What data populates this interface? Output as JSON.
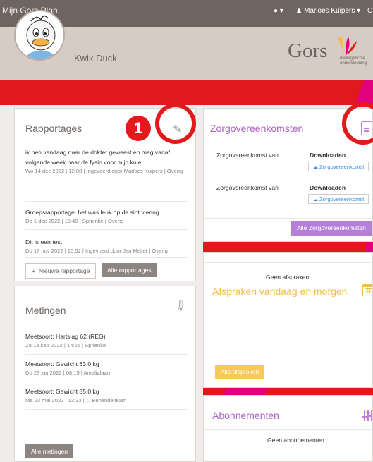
{
  "app": {
    "title": "Mijn Gors Plan"
  },
  "topbar": {
    "info_icon": "info-icon",
    "info_caret": "▾",
    "user_name": "Marloes Kuipers",
    "user_caret": "▾",
    "trail": "C"
  },
  "profile": {
    "name": "Kwik Duck"
  },
  "logo": {
    "word": "Gors",
    "tagline_1": "meesgerichte",
    "tagline_2": "ondersteuning"
  },
  "rapportages": {
    "title": "Rapportages",
    "items": [
      {
        "text": "ik ben vandaag naar de dokter geweest en mag vanaf volgende week naar de fysio voor mijn knie",
        "meta": "Wo 14 dec 2022 | 12:08 | Ingevoerd door Marloes Kuipers | Overig"
      },
      {
        "text": "Groepsrapportage: het was leuk op de sint viering",
        "meta": "Do 1 dec 2022 | 15:40 | Sprienke | Overig"
      },
      {
        "text": "Dit is een test",
        "meta": "Do 17 nov 2022 | 15:52 | Ingevoerd door Jan Meijer | Overig"
      }
    ],
    "new_button": "Nieuwe rapportage",
    "new_button_icon": "+",
    "all_button": "Alle rapportages"
  },
  "metingen": {
    "title": "Metingen",
    "items": [
      {
        "text": "Meetsoort: Hartslag 62 (REG)",
        "meta": "Zo 18 sep 2022 | 14:26 | Sprienke"
      },
      {
        "text": "Meetsoort: Gewicht 63,0 kg",
        "meta": "Do 23 jun 2022 | 08:19 | Amalialaan"
      },
      {
        "text": "Meetsoort: Gewicht 85,0 kg",
        "meta": "Ma 23 mei 2022 | 13:33 | ... Behandelteam"
      }
    ],
    "all_button": "Alle metingen"
  },
  "zorg": {
    "title": "Zorgovereenkomsten",
    "rows": [
      {
        "label": "Zorgovereenkomst van",
        "download": "Downloaden",
        "file_button": "Zorgovereenkomst"
      },
      {
        "label": "Zorgovereenkomst van",
        "download": "Downloaden",
        "file_button": "Zorgovereenkomst"
      }
    ],
    "all_button": "Alle Zorgovereenkomsten"
  },
  "afspraken": {
    "title": "Afspraken vandaag en morgen",
    "empty": "Geen afspraken",
    "all_button": "Alle afspraken"
  },
  "abonnementen": {
    "title": "Abonnementen",
    "empty": "Geen abonnementen"
  },
  "annotation": {
    "badge": "1"
  },
  "colors": {
    "topbar": "#6f6560",
    "red": "#e1191c",
    "pink": "#e3007e",
    "purple": "#b57fd9",
    "yellow": "#f7ca55",
    "profile_bg": "#d7ccc5"
  }
}
